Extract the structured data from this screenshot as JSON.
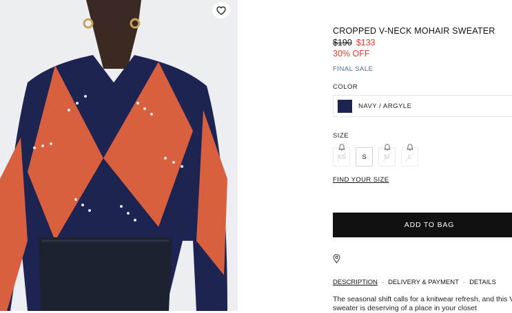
{
  "product": {
    "title": "CROPPED V-NECK MOHAIR SWEATER",
    "price_original": "$190",
    "price_sale": "$133",
    "discount": "30% OFF",
    "final_sale": "FINAL SALE"
  },
  "color": {
    "label": "COLOR",
    "selected": "NAVY / ARGYLE",
    "swatch_color": "#1b2350"
  },
  "size": {
    "label": "SIZE",
    "options": [
      {
        "label": "XS",
        "available": false
      },
      {
        "label": "S",
        "available": true
      },
      {
        "label": "M",
        "available": false
      },
      {
        "label": "L",
        "available": false
      }
    ],
    "find_your_size": "FIND YOUR SIZE"
  },
  "actions": {
    "add_to_bag": "ADD TO BAG"
  },
  "tabs": {
    "description": "DESCRIPTION",
    "sep1": "-",
    "delivery": "DELIVERY & PAYMENT",
    "sep2": "-",
    "details": "DETAILS"
  },
  "description_text": "The seasonal shift calls for a knitwear refresh, and this V-neck sweater is deserving of a place in your closet",
  "icons": {
    "wishlist": "heart-icon",
    "store_locator": "location-pin-icon",
    "notify": "bell-icon"
  },
  "colors": {
    "sale_red": "#e0402a",
    "final_sale_blue": "#4a6a8a",
    "button_black": "#111111",
    "sweater_navy": "#1e2452",
    "sweater_orange": "#d9603f"
  }
}
